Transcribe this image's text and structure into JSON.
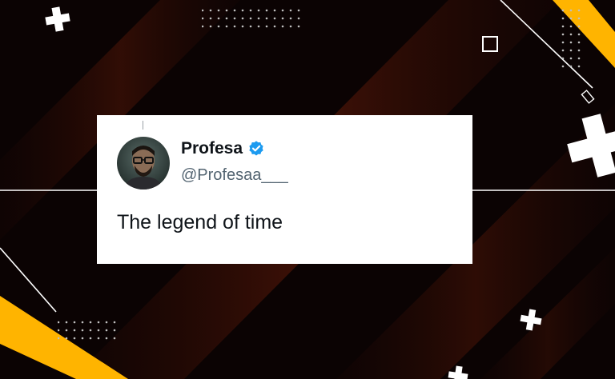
{
  "tweet": {
    "display_name": "Profesa",
    "handle": "@Profesaa___",
    "verified": true,
    "text": "The legend of time"
  },
  "colors": {
    "background": "#0b0303",
    "stripe": "#3a0f07",
    "accent": "#ffb400",
    "card": "#ffffff",
    "verified_badge": "#1d9bf0",
    "handle": "#536471",
    "text": "#0f1419"
  },
  "icons": [
    "plus-icon",
    "square-outline-icon",
    "verified-badge-icon",
    "dot-grid"
  ]
}
